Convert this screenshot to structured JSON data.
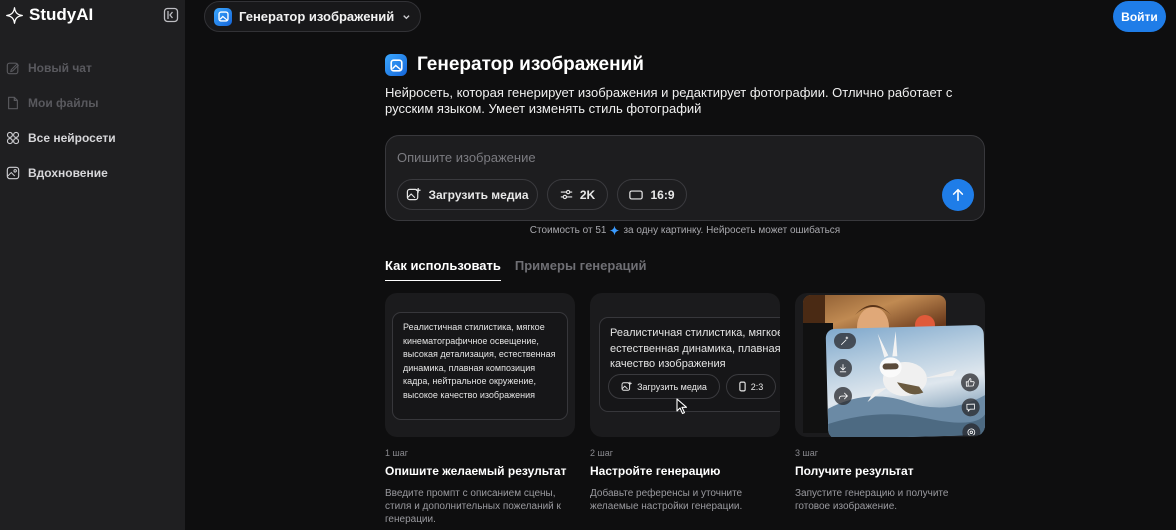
{
  "app": {
    "name": "StudyAI"
  },
  "sidebar": {
    "items": [
      {
        "label": "Новый чат"
      },
      {
        "label": "Мои файлы"
      },
      {
        "label": "Все нейросети"
      },
      {
        "label": "Вдохновение"
      }
    ]
  },
  "header": {
    "model_label": "Генератор изображений",
    "login_label": "Войти"
  },
  "main": {
    "title": "Генератор изображений",
    "description": "Нейросеть, которая генерирует изображения и редактирует фотографии. Отлично работает с русским языком. Умеет изменять стиль фотографий",
    "prompt": {
      "value": "",
      "placeholder": "Опишите изображение",
      "upload_label": "Загрузить медиа",
      "quality_label": "2K",
      "ratio_label": "16:9"
    },
    "cost_prefix": "Стоимость от 51",
    "cost_suffix": "за одну картинку. Нейросеть может ошибаться",
    "tabs": [
      {
        "label": "Как использовать",
        "active": true
      },
      {
        "label": "Примеры генераций",
        "active": false
      }
    ],
    "steps": [
      {
        "num": "1 шаг",
        "title": "Опишите желаемый результат",
        "desc": "Введите промпт с описанием сцены, стиля и дополнительных пожеланий к генерации.",
        "card_text": "Реалистичная стилистика, мягкое кинематографичное освещение, высокая детализация, естественная динамика, плавная композиция кадра, нейтральное окружение, высокое качество изображения"
      },
      {
        "num": "2 шаг",
        "title": "Настройте генерацию",
        "desc": "Добавьте референсы и уточните желаемые настройки генерации.",
        "card_text": "Реалистичная стилистика, мягкое естественная динамика, плавная качество изображения",
        "upload_label": "Загрузить медиа",
        "ratio_label": "2:3"
      },
      {
        "num": "3 шаг",
        "title": "Получите результат",
        "desc": "Запустите генерацию и получите готовое изображение."
      }
    ]
  },
  "colors": {
    "accent": "#1f7de8",
    "background": "#0e0e0f",
    "sidebar": "#1f1f21"
  }
}
